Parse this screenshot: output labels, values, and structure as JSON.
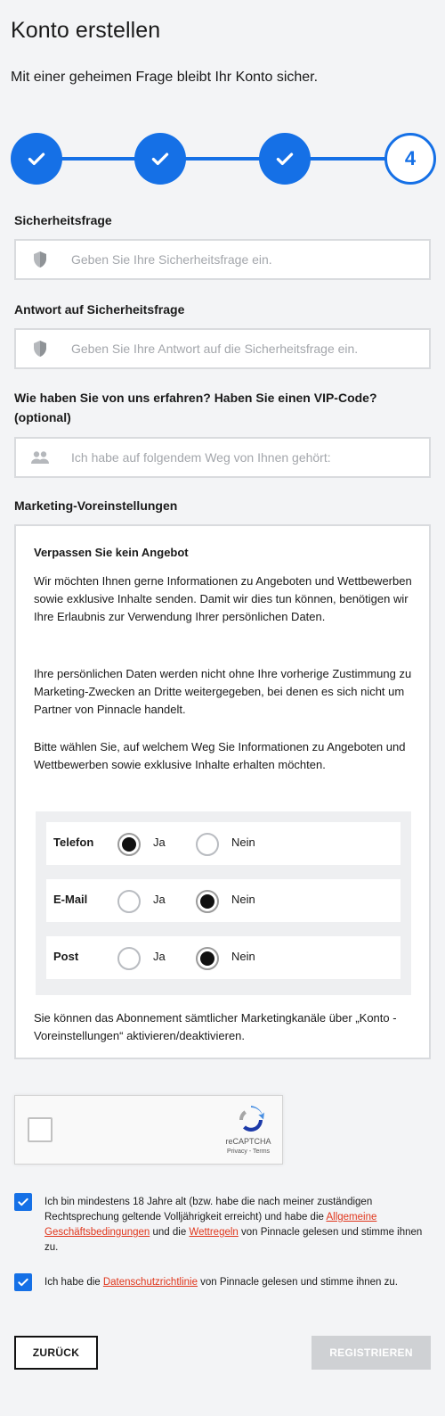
{
  "header": {
    "title": "Konto erstellen",
    "subtitle": "Mit einer geheimen Frage bleibt Ihr Konto sicher."
  },
  "stepper": {
    "completed_steps": 3,
    "current_step": "4",
    "accent_color": "#1570e6"
  },
  "security_question": {
    "label": "Sicherheitsfrage",
    "placeholder": "Geben Sie Ihre Sicherheitsfrage ein.",
    "value": "",
    "icon": "shield-icon"
  },
  "security_answer": {
    "label": "Antwort auf Sicherheitsfrage",
    "placeholder": "Geben Sie Ihre Antwort auf die Sicherheitsfrage ein.",
    "value": "",
    "icon": "shield-icon"
  },
  "referral": {
    "label_line1": "Wie haben Sie von uns erfahren? Haben Sie einen VIP-Code?",
    "label_line2": "(optional)",
    "placeholder": "Ich habe auf folgendem Weg von Ihnen gehört:",
    "value": "",
    "icon": "users-icon"
  },
  "marketing": {
    "section_label": "Marketing-Voreinstellungen",
    "heading": "Verpassen Sie kein Angebot",
    "paragraph1": "Wir möchten Ihnen gerne Informationen zu Angeboten und Wettbewerben sowie exklusive Inhalte senden. Damit wir dies tun können, benötigen wir Ihre Erlaubnis zur Verwendung Ihrer persönlichen Daten.",
    "paragraph2": "Ihre persönlichen Daten werden nicht ohne Ihre vorherige Zustimmung zu Marketing-Zwecken an Dritte weitergegeben, bei denen es sich nicht um Partner von Pinnacle handelt.",
    "paragraph3": "Bitte wählen Sie, auf welchem Weg Sie Informationen zu Angeboten und Wettbewerben sowie exklusive Inhalte erhalten möchten.",
    "yes_label": "Ja",
    "no_label": "Nein",
    "channels": [
      {
        "name": "Telefon",
        "selected": "Ja"
      },
      {
        "name": "E-Mail",
        "selected": "Nein"
      },
      {
        "name": "Post",
        "selected": "Nein"
      }
    ],
    "footer": "Sie können das Abonnement sämtlicher Marketingkanäle über „Konto - Voreinstellungen“ aktivieren/deaktivieren."
  },
  "recaptcha": {
    "brand": "reCAPTCHA",
    "links": "Privacy - Terms"
  },
  "consent_age": {
    "checked": true,
    "text_before": "Ich bin mindestens 18 Jahre alt (bzw. habe die nach meiner zuständigen Rechtsprechung geltende Volljährigkeit erreicht) und habe die ",
    "link1": "Allgemeine Geschäftsbedingungen",
    "text_middle": " und die ",
    "link2": "Wettregeln",
    "text_after": " von Pinnacle gelesen und stimme ihnen zu."
  },
  "consent_privacy": {
    "checked": true,
    "text_before": "Ich habe die ",
    "link": "Datenschutzrichtlinie",
    "text_after": " von Pinnacle gelesen und stimme ihnen zu."
  },
  "buttons": {
    "back": "ZURÜCK",
    "register": "REGISTRIEREN"
  }
}
